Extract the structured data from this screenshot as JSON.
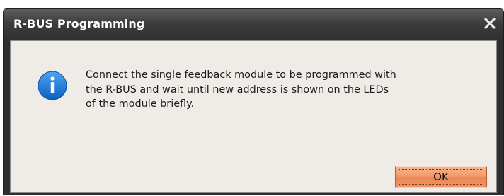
{
  "window": {
    "title": "R-BUS Programming",
    "close_icon": "close-icon"
  },
  "message": {
    "icon": "info-icon",
    "text": "Connect the single feedback module to be programmed with\nthe R-BUS and wait until new address is shown on the LEDs\nof the module briefly."
  },
  "buttons": {
    "ok_label": "OK"
  },
  "colors": {
    "titlebar": "#3c3c3c",
    "client_background": "#efebe6",
    "info_icon": "#1a6fd0",
    "ok_button": "#f29a6c"
  }
}
